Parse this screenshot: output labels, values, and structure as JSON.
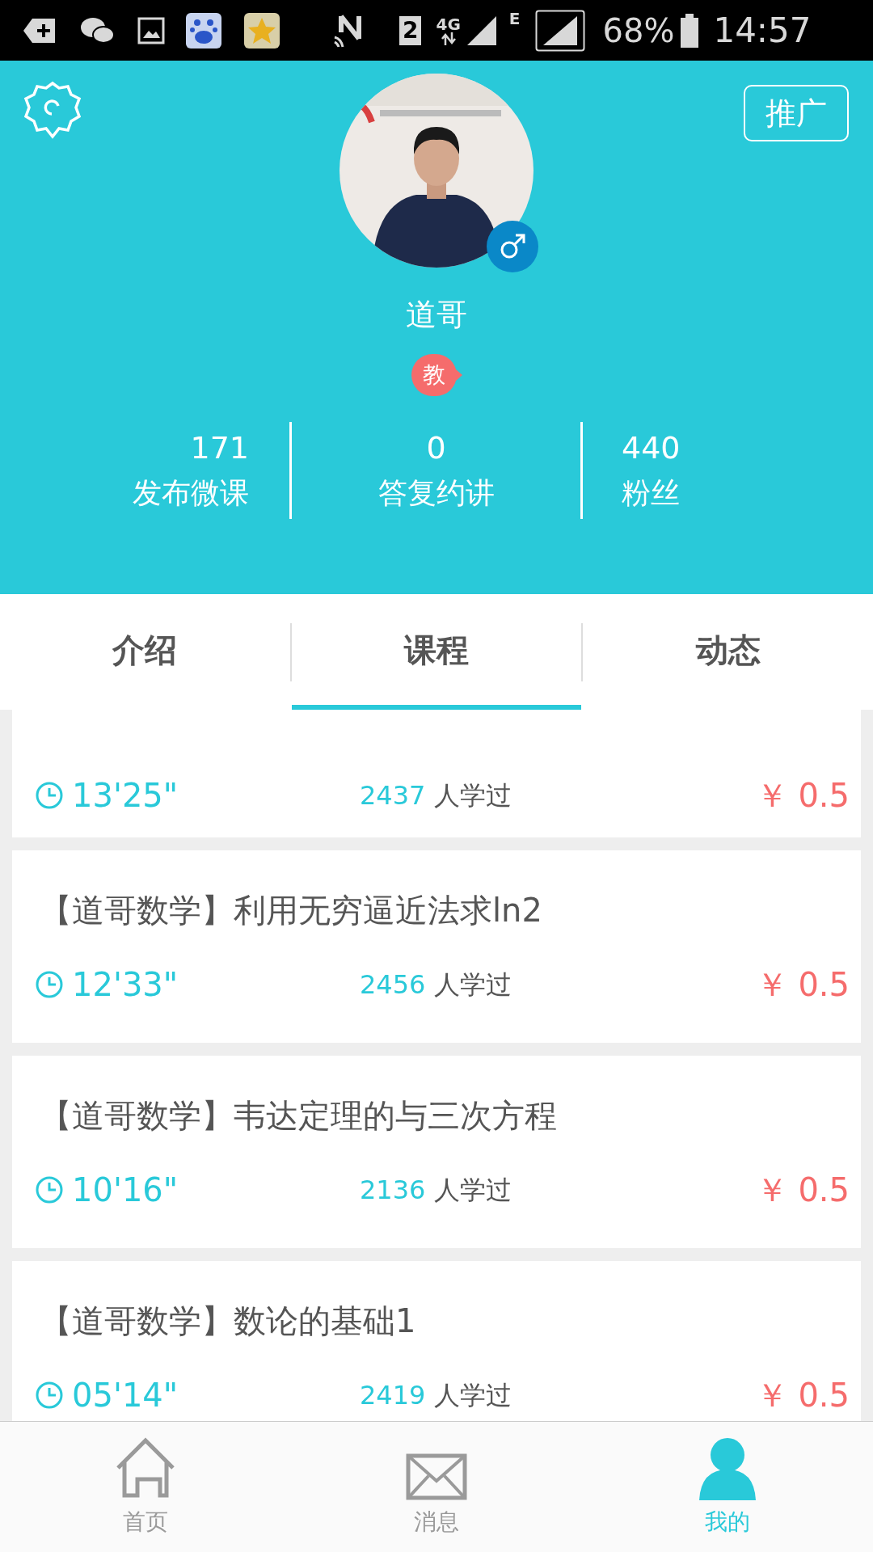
{
  "status_bar": {
    "sim": "2",
    "network": "4G",
    "network_2": "E",
    "battery": "68%",
    "time": "14:57"
  },
  "header": {
    "promote_button": "推广",
    "name": "道哥",
    "role_badge": "教",
    "male": true
  },
  "stats": [
    {
      "value": "171",
      "label": "发布微课"
    },
    {
      "value": "0",
      "label": "答复约讲"
    },
    {
      "value": "440",
      "label": "粉丝"
    }
  ],
  "tabs": [
    {
      "label": "介绍",
      "selected": false
    },
    {
      "label": "课程",
      "selected": true
    },
    {
      "label": "动态",
      "selected": false
    }
  ],
  "courses": [
    {
      "duration": "13'25\"",
      "learners": "2437",
      "learners_suffix": "人学过",
      "price": "￥ 0.5"
    },
    {
      "title": "【道哥数学】利用无穷逼近法求ln2",
      "duration": "12'33\"",
      "learners": "2456",
      "learners_suffix": "人学过",
      "price": "￥ 0.5"
    },
    {
      "title": "【道哥数学】韦达定理的与三次方程",
      "duration": "10'16\"",
      "learners": "2136",
      "learners_suffix": "人学过",
      "price": "￥ 0.5"
    },
    {
      "title": "【道哥数学】数论的基础1",
      "duration": "05'14\"",
      "learners": "2419",
      "learners_suffix": "人学过",
      "price": "￥ 0.5"
    }
  ],
  "bottom_nav": [
    {
      "label": "首页",
      "kind": "home",
      "selected": false
    },
    {
      "label": "消息",
      "kind": "mail",
      "selected": false
    },
    {
      "label": "我的",
      "kind": "person",
      "selected": true
    }
  ]
}
